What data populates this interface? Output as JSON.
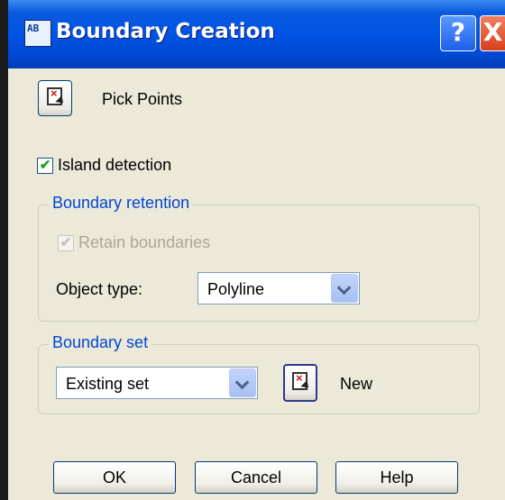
{
  "window": {
    "title": "Boundary Creation",
    "icon_text": "AB",
    "help_glyph": "?",
    "close_glyph": "X"
  },
  "pick_points": {
    "label": "Pick Points"
  },
  "island_detection": {
    "label": "Island detection",
    "checked": true
  },
  "boundary_retention": {
    "legend": "Boundary retention",
    "retain_boundaries": {
      "label": "Retain boundaries",
      "checked": true,
      "enabled": false
    },
    "object_type": {
      "label": "Object type:",
      "value": "Polyline"
    }
  },
  "boundary_set": {
    "legend": "Boundary set",
    "selected": "Existing set",
    "new_label": "New"
  },
  "buttons": {
    "ok": "OK",
    "cancel": "Cancel",
    "help": "Help"
  },
  "colors": {
    "titlebar": "#0054E3",
    "dialog_bg": "#ECE9D8",
    "group_legend": "#0046D5",
    "check_mark": "#21A121"
  }
}
